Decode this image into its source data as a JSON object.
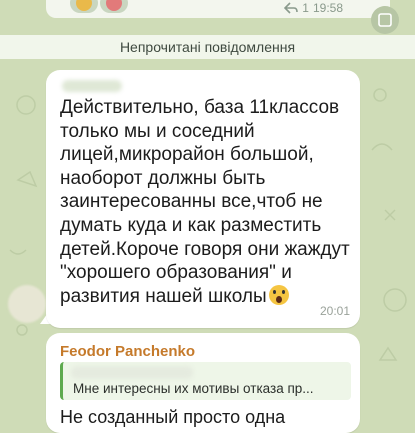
{
  "previous_message": {
    "time": "19:58",
    "read_status": "1"
  },
  "unread_banner": {
    "label": "Непрочитані повідомлення"
  },
  "message": {
    "text": "Действительно, база 11классов\nтолько мы и соседний\nлицей,микрорайон большой,\nнаоборот должны быть\nзаинтересованны все,чтоб не\nдумать куда и как разместить\nдетей.Короче говоря они жаждут\n\"хорошего образования\" и\nразвития нашей школы",
    "emoji": "face-screaming-in-fear-emoji",
    "time": "20:01"
  },
  "reply_message": {
    "sender": "Feodor Panchenko",
    "quoted_text": "Мне интересны их мотивы отказа пр...",
    "text_start": "Не созданный просто одна"
  },
  "colors": {
    "background": "#cfdcb7",
    "bubble": "#ffffff",
    "sender_name": "#c57a2b",
    "reply_accent": "#5eaa4f"
  }
}
